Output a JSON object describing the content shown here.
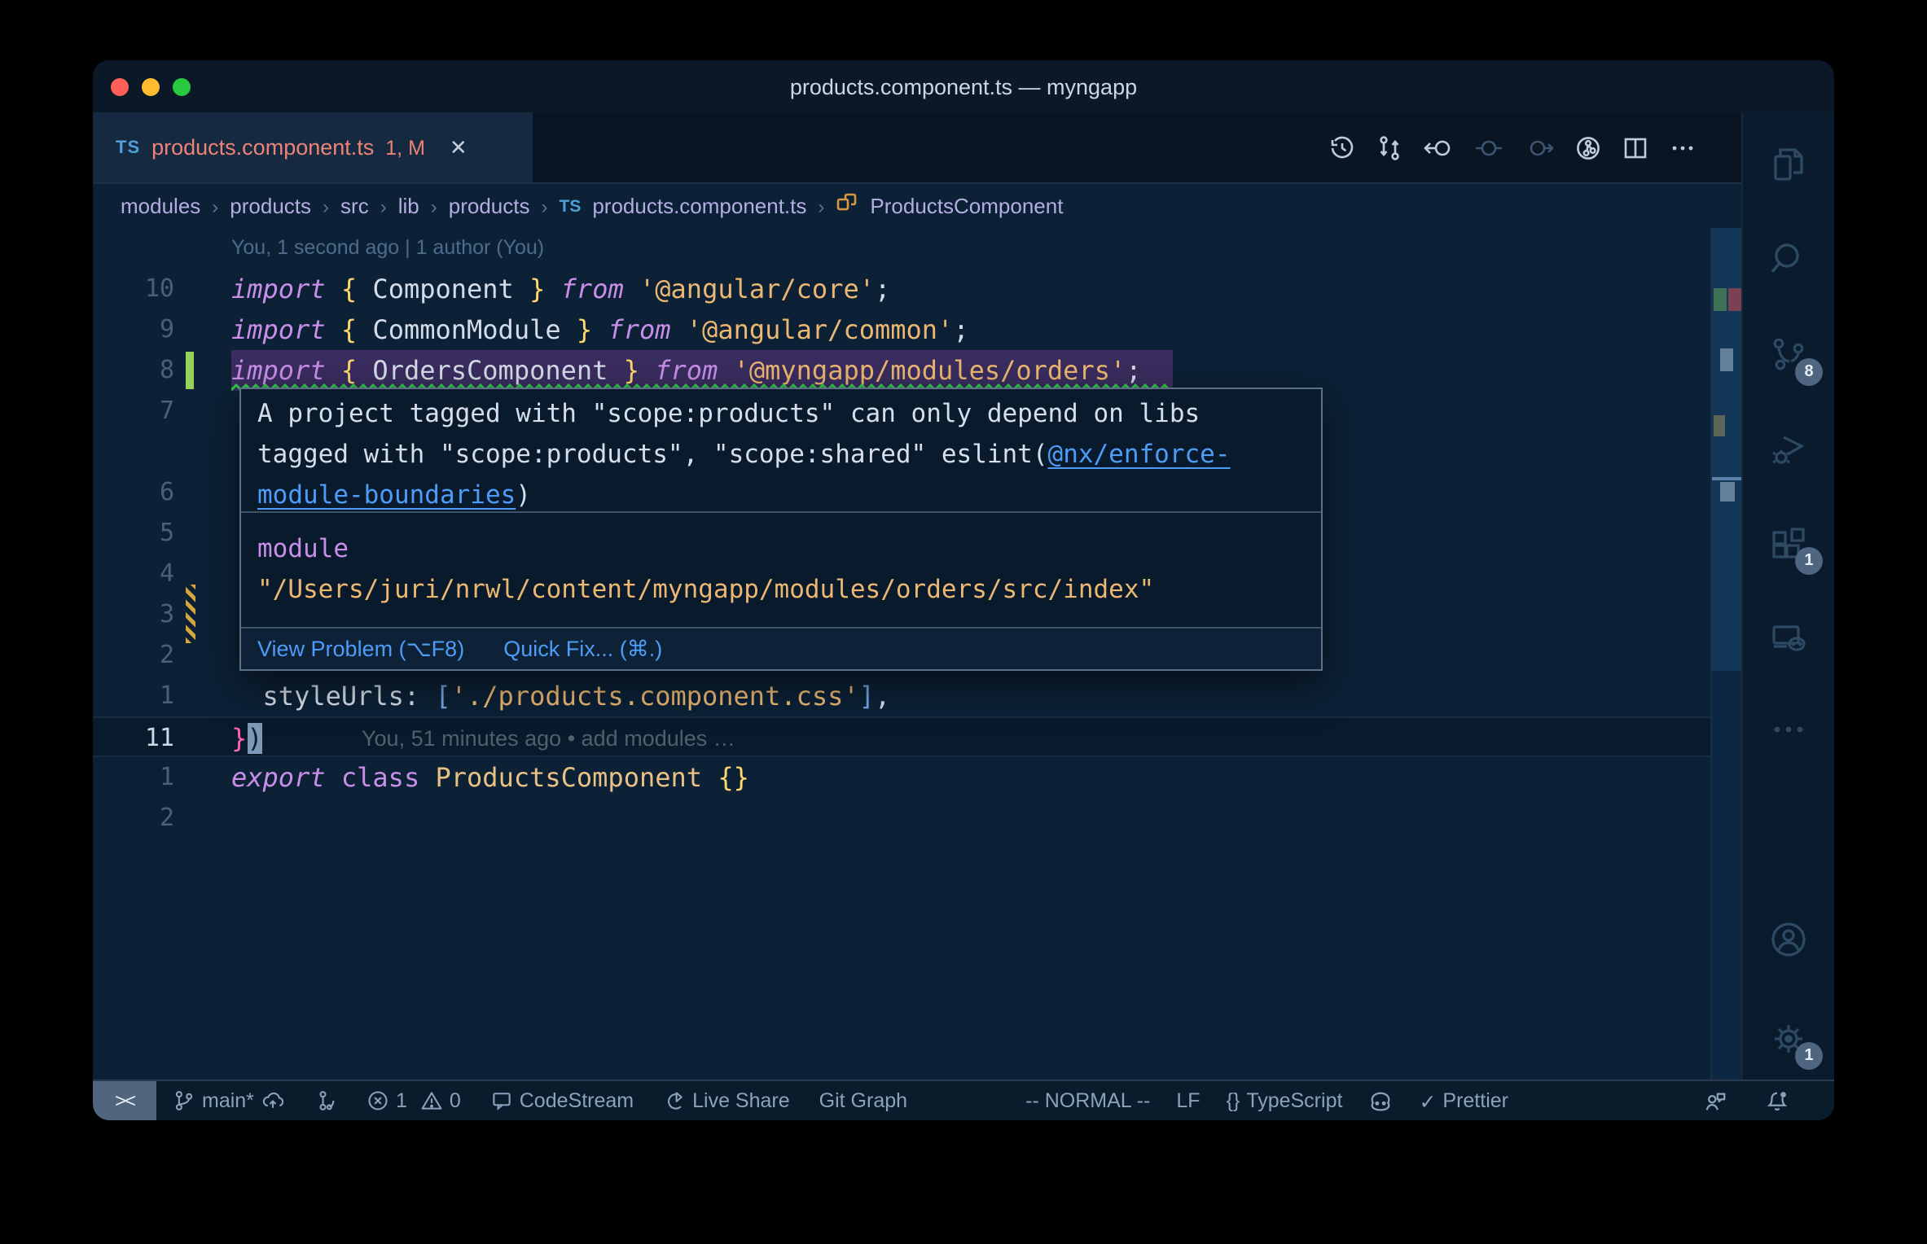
{
  "window": {
    "title": "products.component.ts — myngapp"
  },
  "tab": {
    "language": "TS",
    "filename": "products.component.ts",
    "badge": "1, M",
    "close": "✕"
  },
  "toolbar": {
    "icons": [
      "local-history",
      "compare-changes",
      "navigate-back",
      "previous-change",
      "next-change",
      "git-graph",
      "split-editor",
      "more-actions"
    ]
  },
  "breadcrumb": {
    "folders": [
      "modules",
      "products",
      "src",
      "lib",
      "products"
    ],
    "file": "products.component.ts",
    "symbol": "ProductsComponent",
    "separator": "›"
  },
  "editor": {
    "rows": [
      {
        "blame": "You, 1 second ago | 1 author (You)"
      },
      {
        "num": "10",
        "tokens": [
          [
            "kw",
            "import"
          ],
          [
            "pl",
            " "
          ],
          [
            "br",
            "{"
          ],
          [
            "pl",
            " Component "
          ],
          [
            "br",
            "}"
          ],
          [
            "pl",
            " "
          ],
          [
            "kw",
            "from"
          ],
          [
            "pl",
            " "
          ],
          [
            "str",
            "'@angular/core'"
          ],
          [
            "pl",
            ";"
          ]
        ]
      },
      {
        "num": "9",
        "tokens": [
          [
            "kw",
            "import"
          ],
          [
            "pl",
            " "
          ],
          [
            "br",
            "{"
          ],
          [
            "pl",
            " CommonModule "
          ],
          [
            "br",
            "}"
          ],
          [
            "pl",
            " "
          ],
          [
            "kw",
            "from"
          ],
          [
            "pl",
            " "
          ],
          [
            "str",
            "'@angular/common'"
          ],
          [
            "pl",
            ";"
          ]
        ]
      },
      {
        "num": "8",
        "selected": true,
        "squiggle": true,
        "gutter": "modified",
        "tokens": [
          [
            "kw",
            "import"
          ],
          [
            "pl",
            " "
          ],
          [
            "br",
            "{"
          ],
          [
            "pl",
            " OrdersComponent "
          ],
          [
            "br",
            "}"
          ],
          [
            "pl",
            " "
          ],
          [
            "kw",
            "from"
          ],
          [
            "pl",
            " "
          ],
          [
            "str",
            "'@myngapp/modules/orders'"
          ],
          [
            "pl",
            ";"
          ]
        ]
      },
      {
        "num": "7"
      },
      {},
      {
        "num": "6"
      },
      {
        "num": "5"
      },
      {
        "num": "4"
      },
      {
        "num": "3",
        "gutter": "hatched"
      },
      {
        "num": "2"
      },
      {
        "num": "1",
        "tokens": [
          [
            "pl",
            "  styleUrls: "
          ],
          [
            "brk",
            "["
          ],
          [
            "str",
            "'./products.component.css'"
          ],
          [
            "brk",
            "]"
          ],
          [
            "pl",
            ","
          ]
        ]
      },
      {
        "num": "11",
        "active": true,
        "tokens": [
          [
            "pk",
            "}"
          ],
          [
            "cur",
            ")"
          ]
        ],
        "ghost": "You, 51 minutes ago • add modules …"
      },
      {
        "num": "1",
        "tokens": [
          [
            "kw",
            "export"
          ],
          [
            "pl",
            " "
          ],
          [
            "kw2",
            "class"
          ],
          [
            "pl",
            " "
          ],
          [
            "cls",
            "ProductsComponent"
          ],
          [
            "pl",
            " "
          ],
          [
            "br",
            "{}"
          ]
        ]
      },
      {
        "num": "2"
      }
    ]
  },
  "hover": {
    "message_line1": "A project tagged with \"scope:products\" can only depend on libs",
    "message_line2": "tagged with \"scope:products\", \"scope:shared\" eslint(",
    "link_line1": "@nx/enforce-",
    "link_line2": "module-boundaries",
    "after_link": ")",
    "module_keyword": "module",
    "module_path": "\"/Users/juri/nrwl/content/myngapp/modules/orders/src/index\"",
    "actions": {
      "view_problem": "View Problem (⌥F8)",
      "quick_fix": "Quick Fix... (⌘.)"
    }
  },
  "activity_bar": {
    "items": [
      {
        "name": "explorer"
      },
      {
        "name": "search"
      },
      {
        "name": "source-control",
        "badge": "8"
      },
      {
        "name": "run-debug"
      },
      {
        "name": "extensions",
        "badge": "1"
      },
      {
        "name": "remote-explorer"
      },
      {
        "name": "more-views"
      },
      {
        "name": "accounts"
      },
      {
        "name": "settings",
        "badge": "1"
      }
    ]
  },
  "status_bar": {
    "remote_label": "><",
    "branch": "main*",
    "errors": "1",
    "warnings": "0",
    "codestream": "CodeStream",
    "live_share": "Live Share",
    "git_graph": "Git Graph",
    "mode": "-- NORMAL --",
    "eol": "LF",
    "language_prefix": "{}",
    "language": "TypeScript",
    "formatter_check": "✓",
    "formatter": "Prettier"
  },
  "colors": {
    "editor_bg": "#0c2136",
    "selection": "#3a2d5f",
    "squiggle_green": "#2fd046",
    "modified_gutter": "#97d15c",
    "hatched_gutter": "#d7a73f",
    "tab_modified_text": "#ee8277",
    "link_blue": "#4d9cf8",
    "keyword_pink": "#c88ee8",
    "string_peach": "#ecb771",
    "brace_gold": "#ffd76d",
    "overview_marks": [
      "#3f7257",
      "#7c4055",
      "#64819c",
      "#5c6657",
      "#5b82a8"
    ]
  }
}
